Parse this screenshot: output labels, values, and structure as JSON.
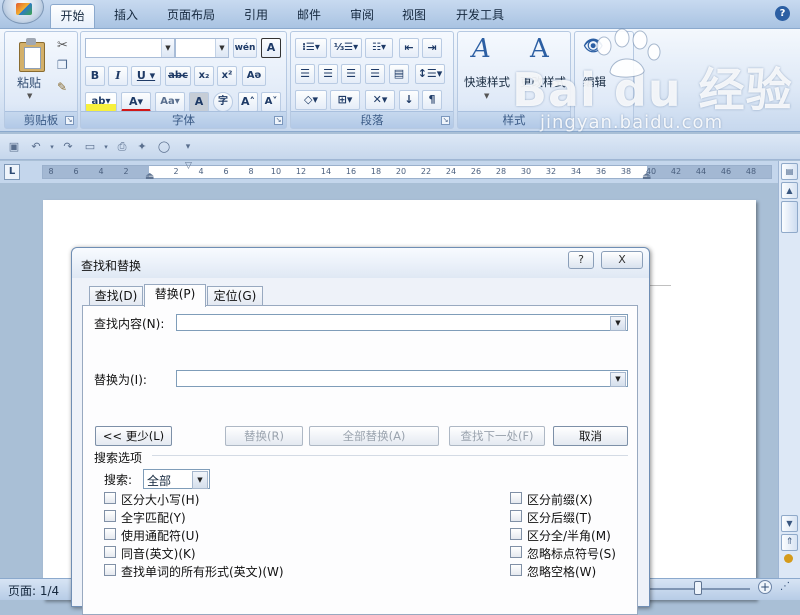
{
  "ribbon": {
    "tabs": [
      "开始",
      "插入",
      "页面布局",
      "引用",
      "邮件",
      "审阅",
      "视图",
      "开发工具"
    ],
    "groups": {
      "clipboard": {
        "label": "剪贴板",
        "paste": "粘贴"
      },
      "font": {
        "label": "字体"
      },
      "paragraph": {
        "label": "段落"
      },
      "styles": {
        "label": "样式",
        "quick_styles": "快速样式",
        "change_styles": "更改样式"
      },
      "editing": {
        "label": "编辑"
      }
    }
  },
  "ruler": {
    "corner": "L",
    "ticks": [
      "8",
      "6",
      "4",
      "2",
      "2",
      "4",
      "6",
      "8",
      "10",
      "12",
      "14",
      "16",
      "18",
      "20",
      "22",
      "24",
      "26",
      "28",
      "30",
      "32",
      "34",
      "36",
      "38",
      "40",
      "42",
      "44",
      "46",
      "48"
    ]
  },
  "statusbar": {
    "page": "页面: 1/4"
  },
  "watermark": {
    "logo": "Bai du 经验",
    "url": "jingyan.baidu.com"
  },
  "dialog": {
    "title": "查找和替换",
    "help": "?",
    "close": "X",
    "tabs": {
      "find": "查找(D)",
      "replace": "替换(P)",
      "goto": "定位(G)"
    },
    "find_label": "查找内容(N):",
    "find_value": "",
    "replace_label": "替换为(I):",
    "replace_value": "",
    "buttons": {
      "less": "<< 更少(L)",
      "replace": "替换(R)",
      "replace_all": "全部替换(A)",
      "find_next": "查找下一处(F)",
      "cancel": "取消"
    },
    "search_options": {
      "heading": "搜索选项",
      "search_label": "搜索:",
      "search_value": "全部",
      "left": [
        {
          "label": "区分大小写(H)",
          "checked": false
        },
        {
          "label": "全字匹配(Y)",
          "checked": false
        },
        {
          "label": "使用通配符(U)",
          "checked": false
        },
        {
          "label": "同音(英文)(K)",
          "checked": false
        },
        {
          "label": "查找单词的所有形式(英文)(W)",
          "checked": false
        }
      ],
      "right": [
        {
          "label": "区分前缀(X)",
          "checked": false
        },
        {
          "label": "区分后缀(T)",
          "checked": false
        },
        {
          "label": "区分全/半角(M)",
          "checked": false
        },
        {
          "label": "忽略标点符号(S)",
          "checked": false
        },
        {
          "label": "忽略空格(W)",
          "checked": false
        }
      ]
    }
  }
}
